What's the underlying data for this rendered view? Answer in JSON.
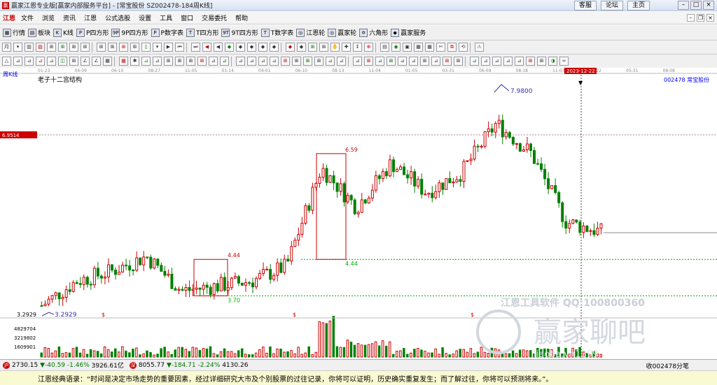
{
  "window": {
    "title": "赢家江恩专业版[赢家内部服务平台] - [常宝股份  SZ002478-184周K线]",
    "quick_links": [
      "客服",
      "论坛",
      "主页"
    ]
  },
  "menu": {
    "logo": "江恩",
    "items": [
      "文件",
      "浏览",
      "资讯",
      "江恩",
      "公式选股",
      "设置",
      "工具",
      "窗口",
      "交易委托",
      "帮助"
    ]
  },
  "toolbar1": [
    "行情",
    "板块",
    "K线",
    "P四方形",
    "9P四方形",
    "P数字表",
    "T四方形",
    "9T四方形",
    "T数字表",
    "江恩轮",
    "赢家轮",
    "六角形",
    "赢家服务"
  ],
  "toolbar1_icons": [
    "▦",
    "▤",
    "K",
    "P",
    "9P",
    "P",
    "T",
    "9T",
    "T",
    "◎",
    "◎",
    "✡",
    "◆"
  ],
  "toolbar2_icons": [
    "月",
    "▾",
    "▥",
    "▨",
    "⊞",
    "⊞",
    "⊞",
    "⊞",
    "⊞",
    "⊞",
    "⊞",
    "⊞",
    "▯",
    "▾",
    "▶",
    "⏮",
    "⏭",
    "◀",
    "◀",
    "◆",
    "◆",
    "◆",
    "◆",
    "◆",
    "◆",
    "◆",
    "⊞",
    "⊞",
    "✋",
    "✚",
    "↕",
    "⊕",
    "▤",
    "◉",
    "▣",
    "▦",
    "▦",
    "✂",
    "⧉",
    "⟲",
    "⚠"
  ],
  "toolbar3_icons": [
    "△",
    "⊿",
    "⊿",
    "⊿",
    "⊿",
    "◫",
    "⊞",
    "∠",
    "∠",
    "▦",
    "▦",
    "✱",
    "⊿",
    "⊿",
    "⊞",
    "⊞",
    "⊞",
    "⊞",
    "⊿",
    "⊿",
    "⊿",
    "⊿",
    "⊿",
    "⊿",
    "⊞",
    "⊞",
    "⊞",
    "⊞",
    "⊿",
    "⊿",
    "⊿",
    "⊞",
    "⊿",
    "⊞",
    "⊿",
    "⊿",
    "⊞",
    "⊿",
    "⊞",
    "⊞",
    "⊿",
    "⊿",
    "⊿",
    "⊿",
    "⊿",
    "⊞",
    "⊞",
    "◑",
    "∞"
  ],
  "chart": {
    "period_label": "周K线",
    "indicator_name": "老子十二宫结构",
    "stock_code": "002478",
    "stock_name": "常宝股份",
    "price_tag": "6.9514",
    "cursor_date": "2023-12-22",
    "bottom_price": "3.2929",
    "volume_ticks": [
      "4829704",
      "3219802",
      "1609901"
    ],
    "watermark_line1": "江恩工具软件  QQ:100800360",
    "watermark_line2": "赢家聊吧",
    "watermark_line3": "liaoba.vn1399",
    "date_ticks": [
      "01-23",
      "04-09",
      "06-10",
      "08-27",
      "11-05",
      "01-14",
      "04-01",
      "06-10",
      "08-13",
      "11-04",
      "01-05",
      "03-31",
      "06-09",
      "08-18",
      "11-03",
      "03-22",
      "05-31",
      "08-08"
    ],
    "annotations": {
      "high": "7.9800",
      "low": "3.2929",
      "box1_top": "4.44",
      "box1_bottom": "3.70",
      "box2_top": "6.59",
      "box2_bottom": "4.44",
      "dollar": "$"
    },
    "colors": {
      "up": "#cc0000",
      "down": "#008000",
      "annotation": "#3333aa",
      "grid": "#00aa00"
    }
  },
  "chart_data": {
    "type": "candlestick",
    "title": "老子十二宫结构",
    "x": [
      "01-23",
      "04-09",
      "06-10",
      "08-27",
      "11-05",
      "01-14",
      "04-01",
      "06-10",
      "08-13",
      "11-04",
      "01-05",
      "03-31",
      "06-09",
      "08-18",
      "11-03",
      "2023-12-22",
      "03-22",
      "05-31",
      "08-08"
    ],
    "price_range": [
      3.2929,
      7.98
    ],
    "marked_levels": [
      6.9514,
      6.59,
      4.44,
      3.7
    ],
    "close_approx": [
      3.5,
      4.0,
      4.2,
      4.5,
      3.8,
      3.9,
      4.0,
      4.3,
      6.3,
      5.5,
      6.4,
      5.8,
      6.2,
      7.2,
      6.6,
      5.2,
      5.0
    ]
  },
  "status": {
    "sh_value": "2730.15",
    "sh_change": "▼-40.59",
    "sh_pct": "-1.46%",
    "sh_amount": "3926.61亿",
    "sz_value": "8055.77",
    "sz_change": "▼-184.71",
    "sz_pct": "-2.24%",
    "sz_amount": "4130.26",
    "right_text": "收002478分笔"
  },
  "quote": "江恩经典语录：“时间是决定市场走势的重要因素，经过详细研究大市及个别股票的过往记录，你将可以证明，历史确实重复发生；而了解过往，你将可以预测将来。”。"
}
